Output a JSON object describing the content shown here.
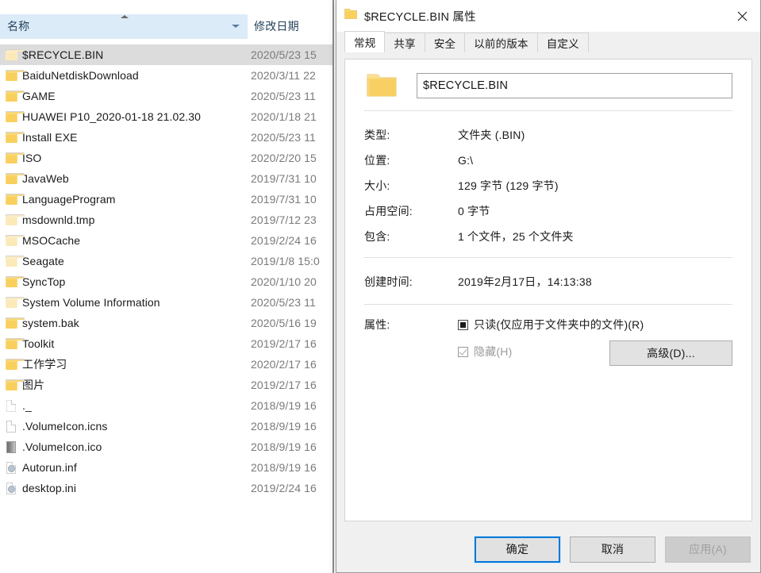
{
  "explorer": {
    "columns": {
      "name": "名称",
      "date_modified": "修改日期"
    },
    "rows": [
      {
        "name": "$RECYCLE.BIN",
        "date": "2020/5/23 15",
        "icon": "folder-icon",
        "dim": true,
        "selected": true
      },
      {
        "name": "BaiduNetdiskDownload",
        "date": "2020/3/11 22",
        "icon": "folder-icon",
        "dim": false,
        "selected": false
      },
      {
        "name": "GAME",
        "date": "2020/5/23 11",
        "icon": "folder-icon",
        "dim": false,
        "selected": false
      },
      {
        "name": "HUAWEI P10_2020-01-18 21.02.30",
        "date": "2020/1/18 21",
        "icon": "folder-icon",
        "dim": false,
        "selected": false
      },
      {
        "name": "Install EXE",
        "date": "2020/5/23 11",
        "icon": "folder-icon",
        "dim": false,
        "selected": false
      },
      {
        "name": "ISO",
        "date": "2020/2/20 15",
        "icon": "folder-icon",
        "dim": false,
        "selected": false
      },
      {
        "name": "JavaWeb",
        "date": "2019/7/31 10",
        "icon": "folder-icon",
        "dim": false,
        "selected": false
      },
      {
        "name": "LanguageProgram",
        "date": "2019/7/31 10",
        "icon": "folder-icon",
        "dim": false,
        "selected": false
      },
      {
        "name": "msdownld.tmp",
        "date": "2019/7/12 23",
        "icon": "folder-icon",
        "dim": true,
        "selected": false
      },
      {
        "name": "MSOCache",
        "date": "2019/2/24 16",
        "icon": "folder-icon",
        "dim": true,
        "selected": false
      },
      {
        "name": "Seagate",
        "date": "2019/1/8 15:0",
        "icon": "folder-icon",
        "dim": true,
        "selected": false
      },
      {
        "name": "SyncTop",
        "date": "2020/1/10 20",
        "icon": "folder-icon",
        "dim": false,
        "selected": false
      },
      {
        "name": "System Volume Information",
        "date": "2020/5/23 11",
        "icon": "folder-icon",
        "dim": true,
        "selected": false
      },
      {
        "name": "system.bak",
        "date": "2020/5/16 19",
        "icon": "folder-icon",
        "dim": false,
        "selected": false
      },
      {
        "name": "Toolkit",
        "date": "2019/2/17 16",
        "icon": "folder-icon",
        "dim": false,
        "selected": false
      },
      {
        "name": "工作学习",
        "date": "2020/2/17 16",
        "icon": "folder-icon",
        "dim": false,
        "selected": false
      },
      {
        "name": "图片",
        "date": "2019/2/17 16",
        "icon": "folder-icon",
        "dim": false,
        "selected": false
      },
      {
        "name": "._",
        "date": "2018/9/19 16",
        "icon": "file-icon",
        "dim": true,
        "selected": false
      },
      {
        "name": ".VolumeIcon.icns",
        "date": "2018/9/19 16",
        "icon": "file-icon",
        "dim": false,
        "selected": false
      },
      {
        "name": ".VolumeIcon.ico",
        "date": "2018/9/19 16",
        "icon": "ico-file-icon",
        "dim": false,
        "selected": false
      },
      {
        "name": "Autorun.inf",
        "date": "2018/9/19 16",
        "icon": "config-file-icon",
        "dim": true,
        "selected": false
      },
      {
        "name": "desktop.ini",
        "date": "2019/2/24 16",
        "icon": "config-file-icon",
        "dim": true,
        "selected": false
      }
    ]
  },
  "dialog": {
    "title": "$RECYCLE.BIN 属性",
    "close_label": "×",
    "tabs": [
      {
        "label": "常规",
        "active": true
      },
      {
        "label": "共享",
        "active": false
      },
      {
        "label": "安全",
        "active": false
      },
      {
        "label": "以前的版本",
        "active": false
      },
      {
        "label": "自定义",
        "active": false
      }
    ],
    "name_field": {
      "value": "$RECYCLE.BIN"
    },
    "info": [
      {
        "label": "类型:",
        "value": "文件夹 (.BIN)"
      },
      {
        "label": "位置:",
        "value": "G:\\"
      },
      {
        "label": "大小:",
        "value": "129 字节 (129 字节)"
      },
      {
        "label": "占用空间:",
        "value": "0 字节"
      },
      {
        "label": "包含:",
        "value": "1 个文件，25 个文件夹"
      }
    ],
    "created": {
      "label": "创建时间:",
      "value": "2019年2月17日，14:13:38"
    },
    "attributes": {
      "label": "属性:",
      "readonly": {
        "text": "只读(仅应用于文件夹中的文件)(R)",
        "state": "indeterminate"
      },
      "hidden": {
        "text": "隐藏(H)",
        "state": "checked-disabled"
      },
      "advanced_button": "高级(D)..."
    },
    "footer": {
      "ok": "确定",
      "cancel": "取消",
      "apply": "应用(A)"
    },
    "accent_color": "#0078d7"
  }
}
